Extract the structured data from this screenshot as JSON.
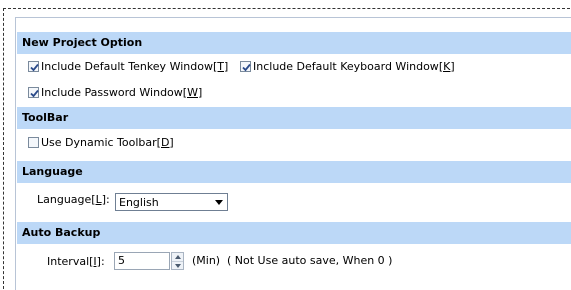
{
  "sections": {
    "new_project": {
      "title": "New Project Option",
      "tenkey": {
        "label": "Include Default Tenkey Window",
        "key": "[T]",
        "checked": true
      },
      "keyboard": {
        "label": "Include Default Keyboard Window",
        "key": "[K]",
        "checked": true
      },
      "password": {
        "label": "Include Password Window",
        "key": "[W]",
        "checked": true
      }
    },
    "toolbar": {
      "title": "ToolBar",
      "dynamic": {
        "label": "Use Dynamic Toolbar",
        "key": "[D]",
        "checked": false
      }
    },
    "language": {
      "title": "Language",
      "label": "Language",
      "key": "[L]",
      "colon": " :",
      "selected": "English"
    },
    "backup": {
      "title": "Auto Backup",
      "interval_label": "Interval",
      "interval_key": "[I]",
      "colon": " :",
      "interval_value": "5",
      "unit": "(Min)",
      "note": "( Not Use auto save, When 0 )"
    }
  },
  "colors": {
    "section_header_bg": "#bcd8f7",
    "checkmark": "#2a4a8a"
  },
  "icons": {
    "checkbox_checked": "checkmark-icon",
    "dropdown": "chevron-down-icon",
    "spin_up": "spin-up-icon",
    "spin_down": "spin-down-icon"
  }
}
